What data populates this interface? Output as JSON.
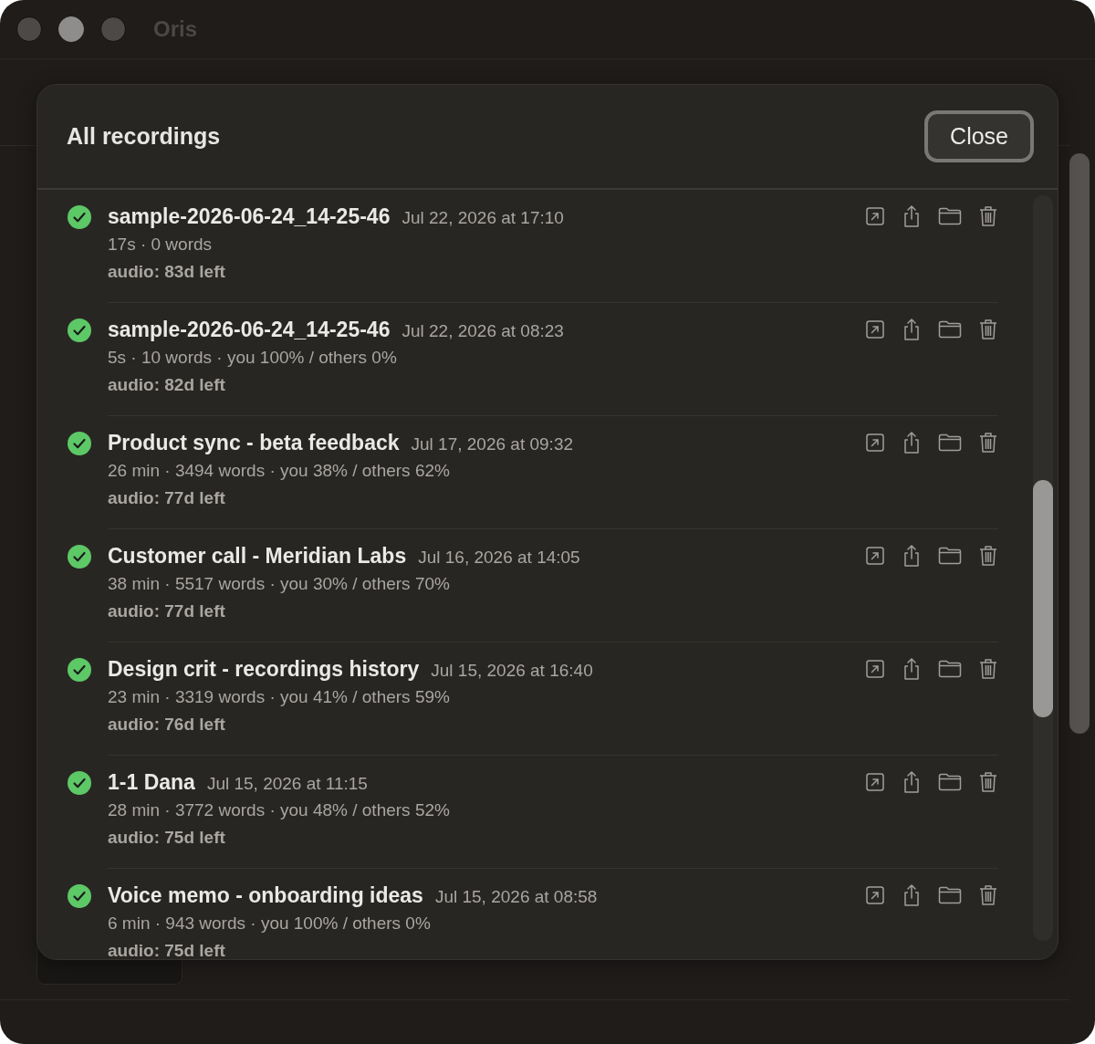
{
  "window": {
    "title": "Oris"
  },
  "sheet": {
    "title": "All recordings",
    "close_button": "Close",
    "recordings": [
      {
        "completed": true,
        "title": "sample-2026-06-24_14-25-46",
        "date": "Jul 22, 2026 at 17:10",
        "meta": "17s · 0 words",
        "audio": "audio: 83d left"
      },
      {
        "completed": true,
        "title": "sample-2026-06-24_14-25-46",
        "date": "Jul 22, 2026 at 08:23",
        "meta": "5s · 10 words · you 100% / others 0%",
        "audio": "audio: 82d left"
      },
      {
        "completed": true,
        "title": "Product sync - beta feedback",
        "date": "Jul 17, 2026 at 09:32",
        "meta": "26 min · 3494 words · you 38% / others 62%",
        "audio": "audio: 77d left"
      },
      {
        "completed": true,
        "title": "Customer call - Meridian Labs",
        "date": "Jul 16, 2026 at 14:05",
        "meta": "38 min · 5517 words · you 30% / others 70%",
        "audio": "audio: 77d left"
      },
      {
        "completed": true,
        "title": "Design crit - recordings history",
        "date": "Jul 15, 2026 at 16:40",
        "meta": "23 min · 3319 words · you 41% / others 59%",
        "audio": "audio: 76d left"
      },
      {
        "completed": true,
        "title": "1-1 Dana",
        "date": "Jul 15, 2026 at 11:15",
        "meta": "28 min · 3772 words · you 48% / others 52%",
        "audio": "audio: 75d left"
      },
      {
        "completed": true,
        "title": "Voice memo - onboarding ideas",
        "date": "Jul 15, 2026 at 08:58",
        "meta": "6 min · 943 words · you 100% / others 0%",
        "audio": "audio: 75d left"
      }
    ]
  }
}
